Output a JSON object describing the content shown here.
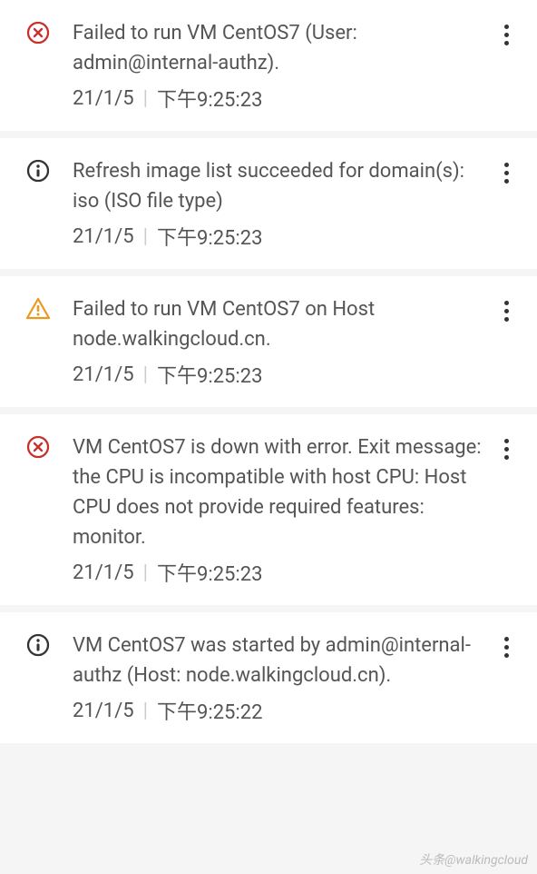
{
  "notifications": [
    {
      "icon": "error",
      "message": "Failed to run VM CentOS7 (User: admin@internal-authz).",
      "date": "21/1/5",
      "time": "下午9:25:23"
    },
    {
      "icon": "info",
      "message": "Refresh image list succeeded for domain(s): iso (ISO file type)",
      "date": "21/1/5",
      "time": "下午9:25:23"
    },
    {
      "icon": "warning",
      "message": "Failed to run VM CentOS7 on Host node.walkingcloud.cn.",
      "date": "21/1/5",
      "time": "下午9:25:23"
    },
    {
      "icon": "error",
      "message": "VM CentOS7 is down with error. Exit message: the CPU is incompatible with host CPU: Host CPU does not provide required features: monitor.",
      "date": "21/1/5",
      "time": "下午9:25:23"
    },
    {
      "icon": "info",
      "message": "VM CentOS7 was started by admin@internal-authz (Host: node.walkingcloud.cn).",
      "date": "21/1/5",
      "time": "下午9:25:22"
    }
  ],
  "divider": "|",
  "watermark": "头条@walkingcloud"
}
